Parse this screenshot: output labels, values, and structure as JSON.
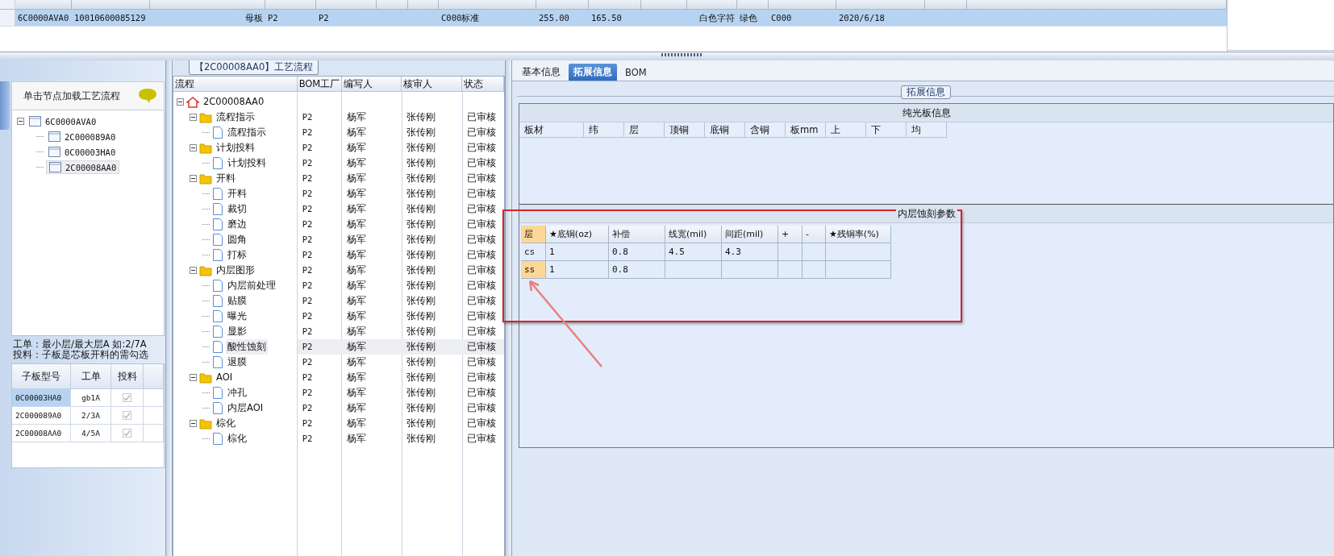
{
  "top_grid": {
    "rows": [
      {
        "selected": true,
        "cells": [
          "6C0000AVA0",
          "10010600085129",
          "母板",
          "P2",
          "P2",
          "C000标准",
          "255.00",
          "165.50",
          "白色字符",
          "绿色",
          "C000",
          "2020/6/18"
        ]
      }
    ]
  },
  "left_panel": {
    "hint": "单击节点加载工艺流程",
    "tree": [
      {
        "label": "6C0000AVA0",
        "expanded": true,
        "selected": false,
        "children": [
          {
            "label": "2C000089A0",
            "selected": false
          },
          {
            "label": "0C00003HA0",
            "selected": false
          },
          {
            "label": "2C00008AA0",
            "selected": true
          }
        ]
      }
    ],
    "note_lines": [
      "工单：最小层/最大层A 如:2/7A",
      "投料：子板是芯板开料的需勾选"
    ],
    "grid": {
      "columns": [
        "子板型号",
        "工单",
        "投料"
      ],
      "rows": [
        {
          "selected": true,
          "cells": [
            "0C00003HA0",
            "gb1A"
          ],
          "checked": true,
          "disabled": true
        },
        {
          "selected": false,
          "cells": [
            "2C000089A0",
            "2/3A"
          ],
          "checked": true,
          "disabled": true
        },
        {
          "selected": false,
          "cells": [
            "2C00008AA0",
            "4/5A"
          ],
          "checked": true,
          "disabled": true
        }
      ]
    }
  },
  "flow": {
    "title": "【2C00008AA0】工艺流程",
    "columns": [
      "流程",
      "BOM工厂",
      "编写人",
      "核审人",
      "状态"
    ],
    "tree": [
      {
        "label": "2C00008AA0",
        "kind": "root",
        "expanded": true,
        "selected": false,
        "children": [
          {
            "label": "流程指示",
            "kind": "folder",
            "expanded": true,
            "selected": false,
            "cells": [
              "P2",
              "杨军",
              "张传刚",
              "已审核"
            ],
            "children": [
              {
                "label": "流程指示",
                "kind": "step",
                "selected": false,
                "cells": [
                  "P2",
                  "杨军",
                  "张传刚",
                  "已审核"
                ]
              }
            ]
          },
          {
            "label": "计划投料",
            "kind": "folder",
            "expanded": true,
            "selected": false,
            "cells": [
              "P2",
              "杨军",
              "张传刚",
              "已审核"
            ],
            "children": [
              {
                "label": "计划投料",
                "kind": "step",
                "selected": false,
                "cells": [
                  "P2",
                  "杨军",
                  "张传刚",
                  "已审核"
                ]
              }
            ]
          },
          {
            "label": "开料",
            "kind": "folder",
            "expanded": true,
            "selected": false,
            "cells": [
              "P2",
              "杨军",
              "张传刚",
              "已审核"
            ],
            "children": [
              {
                "label": "开料",
                "kind": "step",
                "selected": false,
                "cells": [
                  "P2",
                  "杨军",
                  "张传刚",
                  "已审核"
                ]
              },
              {
                "label": "裁切",
                "kind": "step",
                "selected": false,
                "cells": [
                  "P2",
                  "杨军",
                  "张传刚",
                  "已审核"
                ]
              },
              {
                "label": "磨边",
                "kind": "step",
                "selected": false,
                "cells": [
                  "P2",
                  "杨军",
                  "张传刚",
                  "已审核"
                ]
              },
              {
                "label": "圆角",
                "kind": "step",
                "selected": false,
                "cells": [
                  "P2",
                  "杨军",
                  "张传刚",
                  "已审核"
                ]
              },
              {
                "label": "打标",
                "kind": "step",
                "selected": false,
                "cells": [
                  "P2",
                  "杨军",
                  "张传刚",
                  "已审核"
                ]
              }
            ]
          },
          {
            "label": "内层图形",
            "kind": "folder",
            "expanded": true,
            "selected": false,
            "cells": [
              "P2",
              "杨军",
              "张传刚",
              "已审核"
            ],
            "children": [
              {
                "label": "内层前处理",
                "kind": "step",
                "selected": false,
                "cells": [
                  "P2",
                  "杨军",
                  "张传刚",
                  "已审核"
                ]
              },
              {
                "label": "贴膜",
                "kind": "step",
                "selected": false,
                "cells": [
                  "P2",
                  "杨军",
                  "张传刚",
                  "已审核"
                ]
              },
              {
                "label": "曝光",
                "kind": "step",
                "selected": false,
                "cells": [
                  "P2",
                  "杨军",
                  "张传刚",
                  "已审核"
                ]
              },
              {
                "label": "显影",
                "kind": "step",
                "selected": false,
                "cells": [
                  "P2",
                  "杨军",
                  "张传刚",
                  "已审核"
                ]
              },
              {
                "label": "酸性蚀刻",
                "kind": "step",
                "selected": true,
                "cells": [
                  "P2",
                  "杨军",
                  "张传刚",
                  "已审核"
                ]
              },
              {
                "label": "退膜",
                "kind": "step",
                "selected": false,
                "cells": [
                  "P2",
                  "杨军",
                  "张传刚",
                  "已审核"
                ]
              }
            ]
          },
          {
            "label": "AOI",
            "kind": "folder",
            "expanded": true,
            "selected": false,
            "cells": [
              "P2",
              "杨军",
              "张传刚",
              "已审核"
            ],
            "children": [
              {
                "label": "冲孔",
                "kind": "step",
                "selected": false,
                "cells": [
                  "P2",
                  "杨军",
                  "张传刚",
                  "已审核"
                ]
              },
              {
                "label": "内层AOI",
                "kind": "step",
                "selected": false,
                "cells": [
                  "P2",
                  "杨军",
                  "张传刚",
                  "已审核"
                ]
              }
            ]
          },
          {
            "label": "棕化",
            "kind": "folder",
            "expanded": true,
            "selected": false,
            "cells": [
              "P2",
              "杨军",
              "张传刚",
              "已审核"
            ],
            "children": [
              {
                "label": "棕化",
                "kind": "step",
                "selected": false,
                "cells": [
                  "P2",
                  "杨军",
                  "张传刚",
                  "已审核"
                ]
              }
            ]
          }
        ]
      }
    ]
  },
  "detail": {
    "tabs": [
      {
        "label": "基本信息",
        "selected": false
      },
      {
        "label": "拓展信息",
        "selected": true
      },
      {
        "label": "BOM",
        "selected": false
      }
    ],
    "group_title": "拓展信息",
    "bare_board": {
      "title": "纯光板信息",
      "columns": [
        "板材",
        "纬",
        "层",
        "顶铜",
        "底铜",
        "含铜",
        "板mm",
        "上",
        "下",
        "均"
      ]
    },
    "etch": {
      "title": "内层蚀刻参数",
      "columns": [
        "层",
        "★底铜(oz)",
        "补偿",
        "线宽(mil)",
        "间距(mil)",
        "+",
        "-",
        "★残铜率(%)"
      ],
      "rows": [
        {
          "selected": false,
          "cells": [
            "cs",
            "1",
            "0.8",
            "4.5",
            "4.3"
          ]
        },
        {
          "selected": true,
          "cells": [
            "ss",
            "1",
            "0.8"
          ]
        }
      ]
    }
  }
}
